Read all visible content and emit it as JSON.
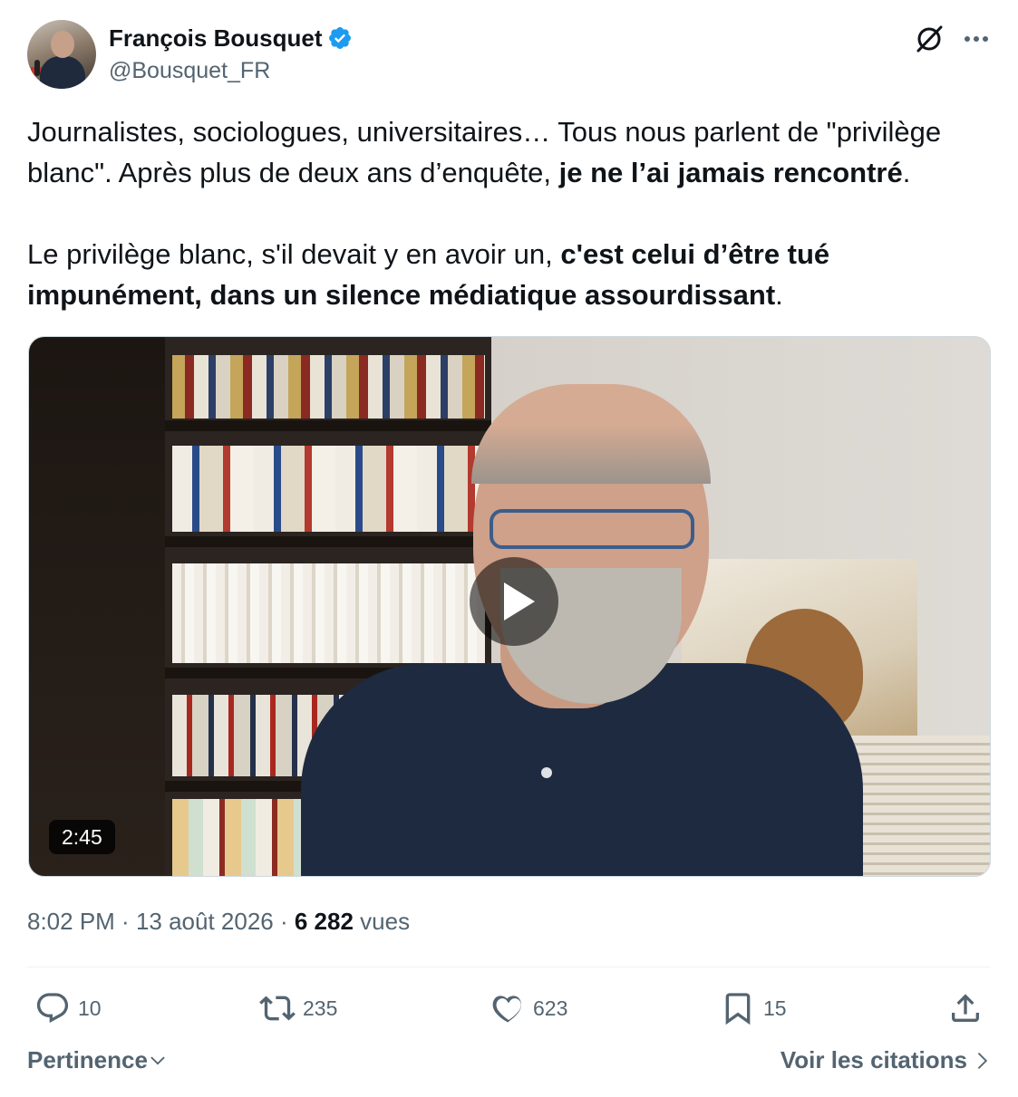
{
  "author": {
    "display_name": "François Bousquet",
    "handle": "@Bousquet_FR",
    "verified": true,
    "avatar_icon": "avatar-photo"
  },
  "header_icons": {
    "grok": "grok-icon",
    "more": "more-icon"
  },
  "tweet": {
    "p1_a": "Journalistes, sociologues, universitaires… Tous nous parlent de \"privilège blanc\". Après plus de deux ans d’enquête, ",
    "p1_b": "je ne l’ai jamais rencontré",
    "p1_c": ".",
    "p2_a": "Le privilège blanc, s'il devait y en avoir un, ",
    "p2_b": "c'est celui d’être tué impunément, dans un silence médiatique assourdissant",
    "p2_c": "."
  },
  "media": {
    "type": "video",
    "duration": "2:45"
  },
  "meta": {
    "time": "8:02 PM",
    "sep1": " · ",
    "date": "13 août 2026",
    "sep2": " · ",
    "views_count": "6 282",
    "views_label": " vues"
  },
  "actions": {
    "replies": "10",
    "reposts": "235",
    "likes": "623",
    "bookmarks": "15"
  },
  "footer": {
    "sort_label": "Pertinence",
    "quotes_label": "Voir les citations"
  },
  "colors": {
    "text": "#0f1419",
    "secondary": "#536471",
    "verified_blue": "#1d9bf0"
  }
}
